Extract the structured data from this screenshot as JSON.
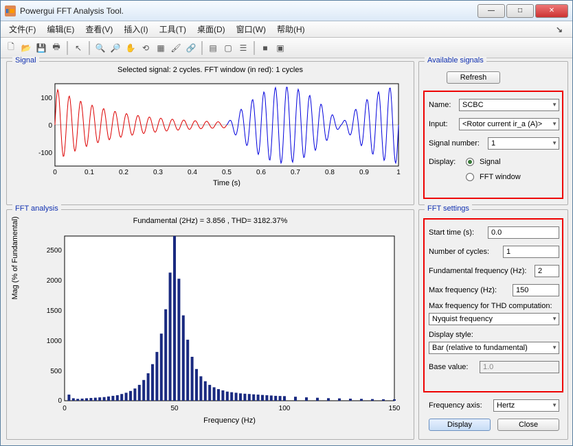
{
  "window": {
    "title": "Powergui FFT Analysis Tool."
  },
  "menu": {
    "file": "文件(F)",
    "edit": "编辑(E)",
    "view": "查看(V)",
    "insert": "插入(I)",
    "tools": "工具(T)",
    "desktop": "桌面(D)",
    "window": "窗口(W)",
    "help": "帮助(H)",
    "helpicon": "↘"
  },
  "signal_panel": {
    "legend": "Signal",
    "title": "Selected signal: 2 cycles. FFT window (in red): 1 cycles",
    "xlabel": "Time (s)",
    "xticks": [
      "0",
      "0.1",
      "0.2",
      "0.3",
      "0.4",
      "0.5",
      "0.6",
      "0.7",
      "0.8",
      "0.9",
      "1"
    ],
    "yticks": [
      "-100",
      "0",
      "100"
    ]
  },
  "fft_panel": {
    "legend": "FFT analysis",
    "title": "Fundamental (2Hz) = 3.856 , THD= 3182.37%",
    "xlabel": "Frequency (Hz)",
    "ylabel": "Mag (% of Fundamental)",
    "xticks": [
      "0",
      "50",
      "100",
      "150"
    ],
    "yticks": [
      "0",
      "500",
      "1000",
      "1500",
      "2000",
      "2500"
    ]
  },
  "avail": {
    "legend": "Available signals",
    "refresh": "Refresh",
    "name_lbl": "Name:",
    "name_val": "SCBC",
    "input_lbl": "Input:",
    "input_val": "<Rotor current ir_a (A)>",
    "signum_lbl": "Signal number:",
    "signum_val": "1",
    "display_lbl": "Display:",
    "opt_signal": "Signal",
    "opt_fftwin": "FFT window"
  },
  "settings": {
    "legend": "FFT settings",
    "start_lbl": "Start time (s):",
    "start_val": "0.0",
    "ncyc_lbl": "Number of cycles:",
    "ncyc_val": "1",
    "fund_lbl": "Fundamental frequency (Hz):",
    "fund_val": "2",
    "maxf_lbl": "Max frequency (Hz):",
    "maxf_val": "150",
    "maxthd_lbl": "Max frequency for THD computation:",
    "maxthd_val": "Nyquist frequency",
    "style_lbl": "Display style:",
    "style_val": "Bar (relative to fundamental)",
    "base_lbl": "Base value:",
    "base_val": "1.0",
    "faxis_lbl": "Frequency axis:",
    "faxis_val": "Hertz",
    "display_btn": "Display",
    "close_btn": "Close"
  },
  "chart_data": [
    {
      "type": "line",
      "title": "Selected signal: 2 cycles. FFT window (in red): 1 cycles",
      "xlabel": "Time (s)",
      "ylabel": "",
      "xlim": [
        0,
        1
      ],
      "ylim": [
        -150,
        150
      ],
      "series": [
        {
          "name": "FFT window (red)",
          "color": "#d00",
          "x_range": [
            0,
            0.5
          ],
          "description": "oscillation ~30 Hz, amplitude decaying from ~130 to ~5"
        },
        {
          "name": "Signal (blue)",
          "color": "#00d",
          "x_range": [
            0.5,
            1
          ],
          "description": "oscillation ~30 Hz, modulated envelope 0→140→60→130"
        }
      ]
    },
    {
      "type": "bar",
      "title": "Fundamental (2Hz) = 3.856 , THD= 3182.37%",
      "xlabel": "Frequency (Hz)",
      "ylabel": "Mag (% of Fundamental)",
      "xlim": [
        0,
        150
      ],
      "ylim": [
        0,
        2700
      ],
      "x": [
        2,
        4,
        6,
        8,
        10,
        12,
        14,
        16,
        18,
        20,
        22,
        24,
        26,
        28,
        30,
        32,
        34,
        36,
        38,
        40,
        42,
        44,
        46,
        48,
        50,
        52,
        54,
        56,
        58,
        60,
        62,
        64,
        66,
        68,
        70,
        72,
        74,
        76,
        78,
        80,
        82,
        84,
        86,
        88,
        90,
        92,
        94,
        96,
        98,
        100,
        105,
        110,
        115,
        120,
        125,
        130,
        135,
        140,
        145,
        150
      ],
      "values": [
        100,
        40,
        30,
        35,
        40,
        45,
        50,
        55,
        60,
        70,
        80,
        90,
        110,
        130,
        160,
        200,
        260,
        340,
        450,
        600,
        800,
        1100,
        1500,
        2100,
        2700,
        2000,
        1400,
        1000,
        720,
        520,
        400,
        320,
        260,
        220,
        190,
        170,
        150,
        140,
        130,
        120,
        115,
        110,
        105,
        100,
        95,
        90,
        85,
        80,
        78,
        75,
        65,
        55,
        48,
        42,
        38,
        34,
        30,
        27,
        24,
        22
      ]
    }
  ]
}
